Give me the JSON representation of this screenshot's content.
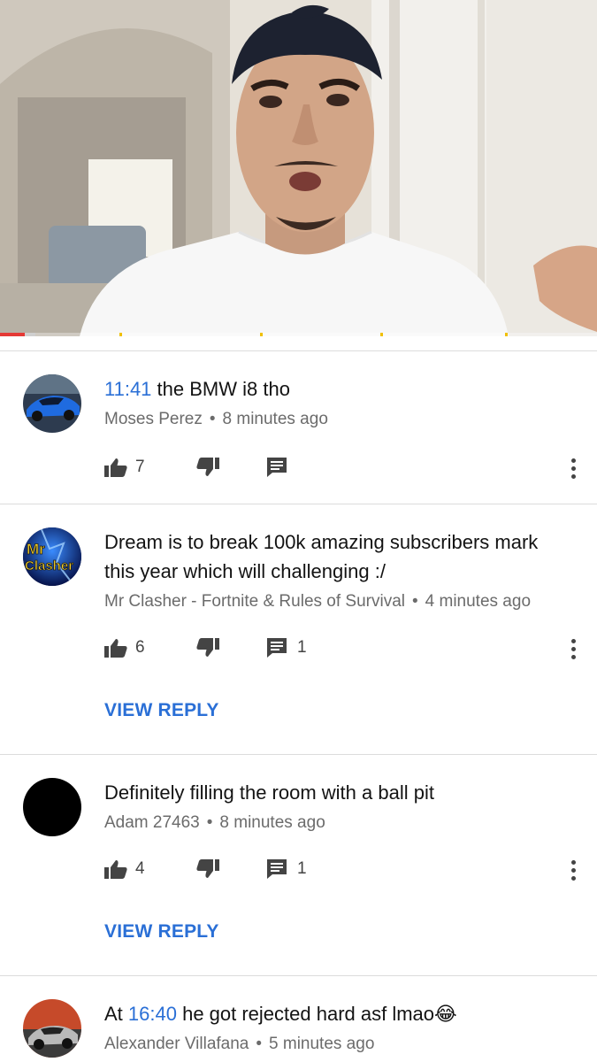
{
  "video": {
    "progress_fraction": 0.041,
    "colors": {
      "played": "#e53935",
      "marker": "#f0c000"
    }
  },
  "comments": [
    {
      "text_prefix": "",
      "timestamp": "11:41",
      "text": " the BMW i8 tho",
      "author": "Moses Perez",
      "time": "8 minutes ago",
      "likes": "7",
      "replies": "",
      "avatar_icon": "blue-car-avatar"
    },
    {
      "text_prefix": "",
      "timestamp": "",
      "text": "Dream is to break 100k amazing subscribers mark this year which will challenging :/",
      "author": "Mr Clasher - Fortnite & Rules of Survival",
      "time": "4 minutes ago",
      "likes": "6",
      "replies": "1",
      "view_reply": "VIEW REPLY",
      "avatar_text": [
        "Mr",
        "Clasher"
      ]
    },
    {
      "text_prefix": "",
      "timestamp": "",
      "text": "Definitely filling the room with a ball pit",
      "author": "Adam 27463",
      "time": "8 minutes ago",
      "likes": "4",
      "replies": "1",
      "view_reply": "VIEW REPLY",
      "avatar_icon": "black-circle-avatar"
    },
    {
      "text_prefix": "At ",
      "timestamp": "16:40",
      "text": " he got rejected hard asf lmao",
      "emoji": "😂",
      "author": "Alexander Villafana",
      "time": "5 minutes ago",
      "avatar_icon": "car-avatar"
    }
  ],
  "dot": "•"
}
